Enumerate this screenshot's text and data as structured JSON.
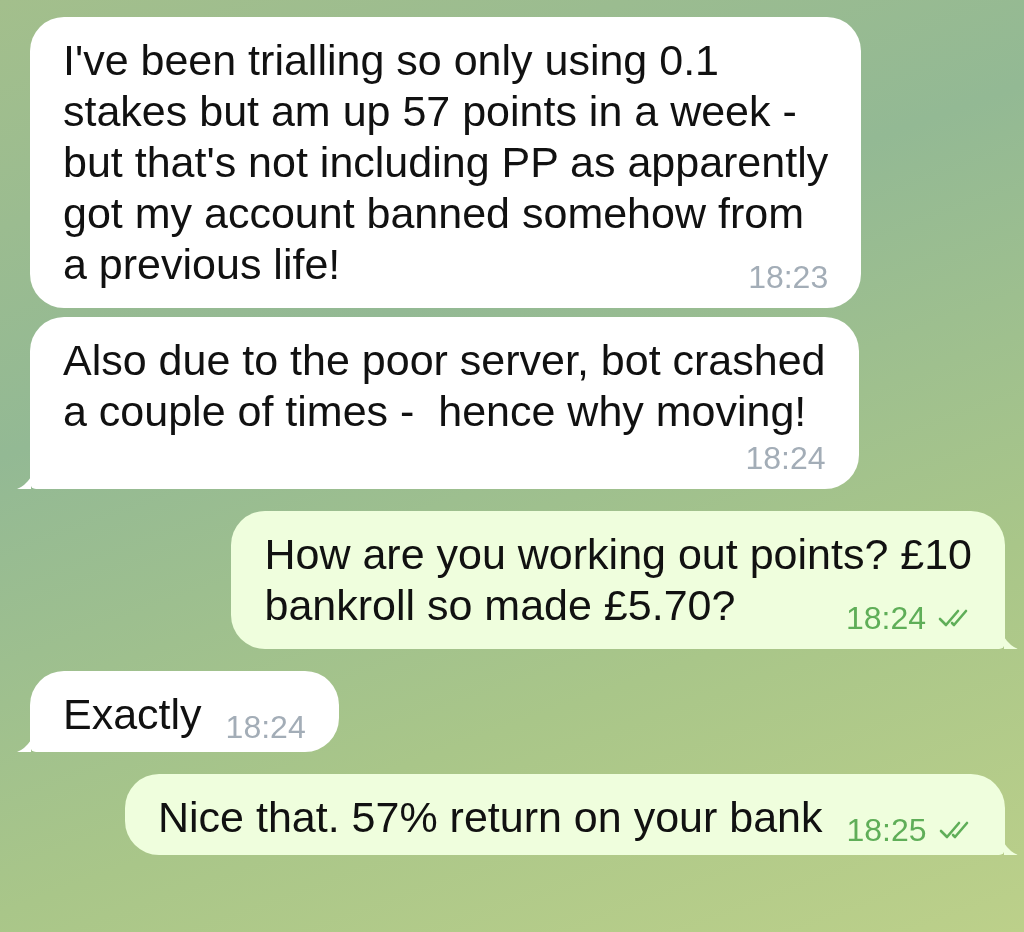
{
  "messages": [
    {
      "outgoing": false,
      "tail": false,
      "lines": [
        "I've been trialling so only using 0.1",
        "stakes but am up 57 points in a week -",
        "but that's not including PP as apparently",
        "got my account banned somehow from",
        "a previous life!"
      ],
      "time": "18:23"
    },
    {
      "outgoing": false,
      "tail": true,
      "lines": [
        "Also due to the poor server, bot crashed",
        "a couple of times -  hence why moving!"
      ],
      "time": "18:24"
    },
    {
      "outgoing": true,
      "tail": true,
      "lines": [
        "How are you working out points? £10",
        "bankroll so made £5.70?"
      ],
      "time": "18:24",
      "read": true
    },
    {
      "outgoing": false,
      "tail": true,
      "lines": [
        "Exactly"
      ],
      "time": "18:24"
    },
    {
      "outgoing": true,
      "tail": true,
      "lines": [
        "Nice that. 57% return on your bank"
      ],
      "time": "18:25",
      "read": true
    }
  ]
}
